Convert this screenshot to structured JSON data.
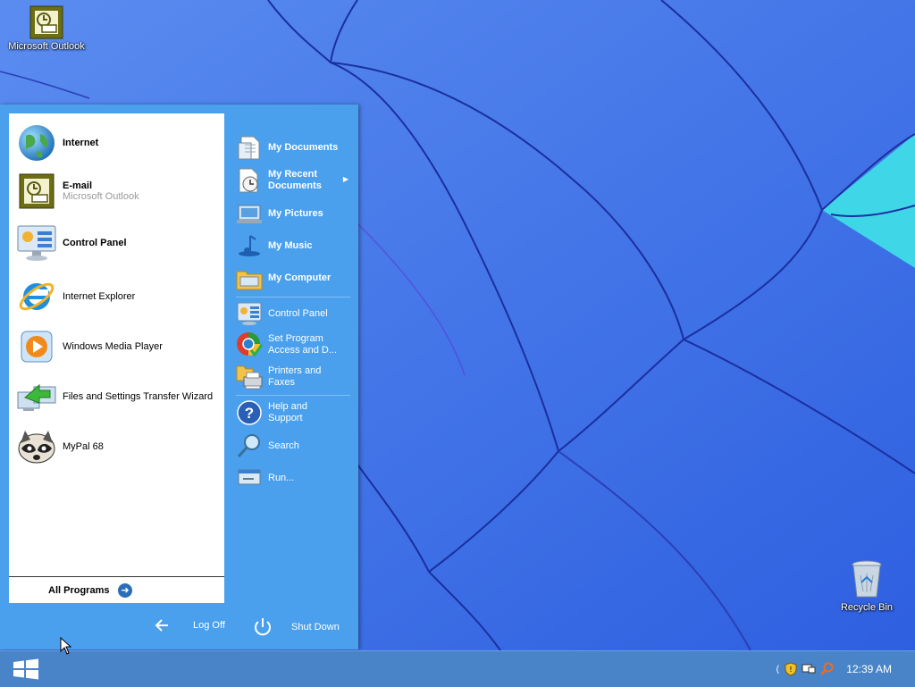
{
  "desktop": {
    "icons": [
      {
        "label": "Microsoft Outlook",
        "icon": "outlook-icon"
      },
      {
        "label": "Recycle Bin",
        "icon": "recycle-bin-icon"
      }
    ]
  },
  "start_menu": {
    "pinned": [
      {
        "label": "Internet",
        "icon": "globe-icon",
        "bold": true
      },
      {
        "label": "E-mail",
        "sublabel": "Microsoft Outlook",
        "icon": "outlook-icon",
        "bold": true
      }
    ],
    "recent": [
      {
        "label": "Control Panel",
        "icon": "control-panel-icon",
        "bold": true
      },
      {
        "label": "Internet Explorer",
        "icon": "ie-icon"
      },
      {
        "label": "Windows Media Player",
        "icon": "media-player-icon"
      },
      {
        "label": "Files and Settings Transfer Wizard",
        "icon": "transfer-wizard-icon"
      },
      {
        "label": "MyPal 68",
        "icon": "mypal-icon"
      }
    ],
    "all_programs": "All Programs",
    "places": [
      {
        "label": "My Documents",
        "icon": "documents-icon"
      },
      {
        "label": "My Recent Documents",
        "icon": "recent-documents-icon"
      },
      {
        "label": "My Pictures",
        "icon": "pictures-icon"
      },
      {
        "label": "My Music",
        "icon": "music-icon"
      },
      {
        "label": "My Computer",
        "icon": "computer-icon"
      },
      {
        "label": "Control Panel",
        "icon": "control-panel-icon"
      },
      {
        "label": "Set Program Access and D...",
        "icon": "program-access-icon"
      },
      {
        "label": "Printers and Faxes",
        "icon": "printer-icon"
      },
      {
        "label": "Help and Support",
        "icon": "help-icon"
      },
      {
        "label": "Search",
        "icon": "search-icon"
      },
      {
        "label": "Run...",
        "icon": "run-icon"
      }
    ],
    "log_off": "Log Off",
    "shut_down": "Shut Down"
  },
  "taskbar": {
    "clock": "12:39 AM",
    "tray_icons": [
      "security-shield-icon",
      "network-icon",
      "search-tray-icon"
    ]
  },
  "colors": {
    "menu_blue": "#4aa0ec",
    "taskbar_blue": "#4a84c8",
    "wallpaper_blue": "#3b6ff0"
  }
}
